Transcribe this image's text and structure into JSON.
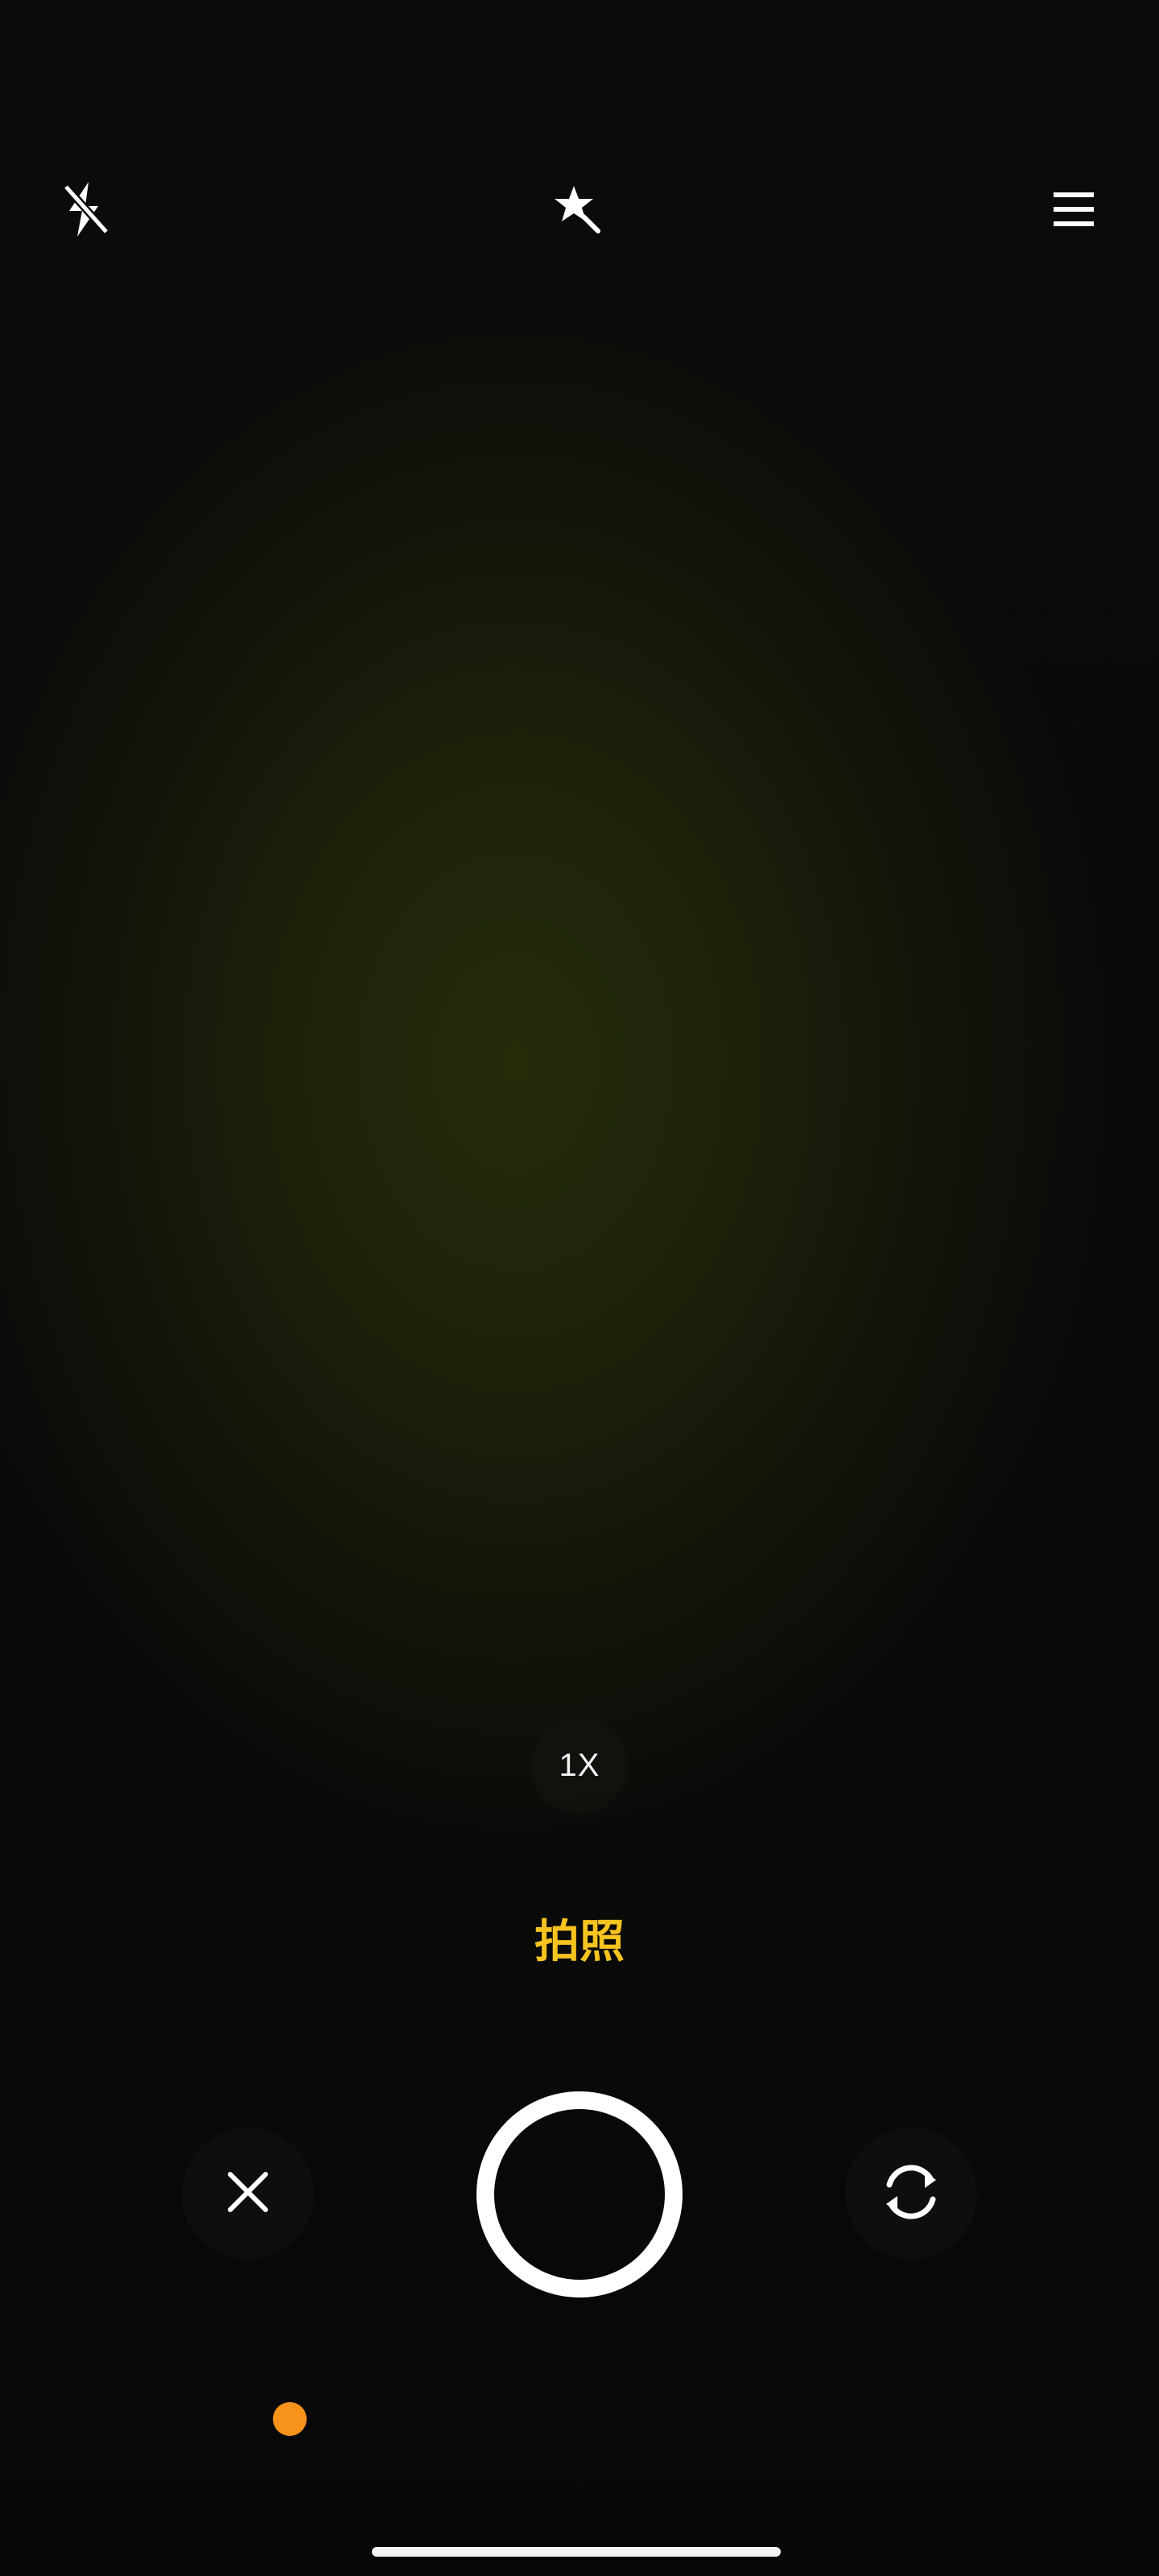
{
  "top_bar": {
    "flash_icon": "flash-off-icon",
    "magic_icon": "magic-wand-icon",
    "menu_icon": "menu-icon"
  },
  "zoom": {
    "label": "1X"
  },
  "mode": {
    "label": "拍照",
    "color": "#f7c31f"
  },
  "controls": {
    "close_icon": "close-icon",
    "shutter_icon": "shutter-button",
    "switch_icon": "switch-camera-icon"
  },
  "indicator": {
    "dot_color": "#f7921a"
  }
}
